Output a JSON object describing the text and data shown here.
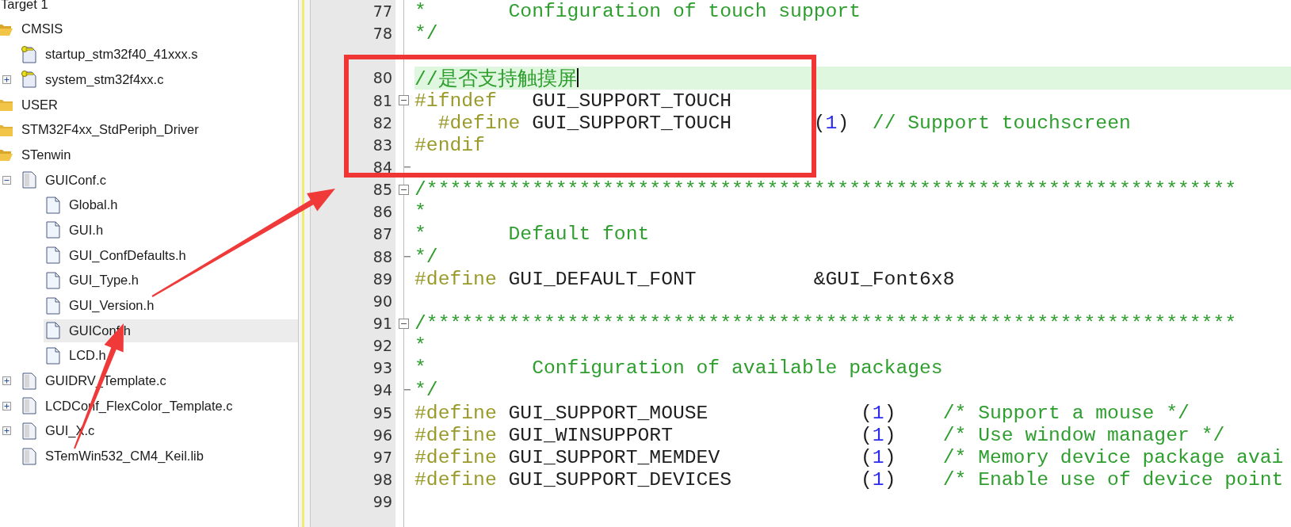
{
  "tree": {
    "items": [
      {
        "label": "Target 1",
        "selected": false,
        "children": [
          {
            "label": "CMSIS",
            "kind": "folder",
            "expanded": true,
            "selected": false,
            "children": [
              {
                "label": "startup_stm32f40_41xxx.s",
                "kind": "key_file",
                "selected": false
              },
              {
                "label": "system_stm32f4xx.c",
                "kind": "key_file",
                "expanded": false,
                "selected": false
              }
            ]
          },
          {
            "label": "USER",
            "kind": "folder",
            "expanded": false,
            "selected": false
          },
          {
            "label": "STM32F4xx_StdPeriph_Driver",
            "kind": "folder",
            "expanded": false,
            "selected": false
          },
          {
            "label": "STenwin",
            "kind": "folder",
            "expanded": true,
            "selected": false,
            "children": [
              {
                "label": "GUIConf.c",
                "kind": "source_file",
                "expanded": true,
                "selected": false,
                "children": [
                  {
                    "label": "Global.h",
                    "kind": "header_file",
                    "selected": false
                  },
                  {
                    "label": "GUI.h",
                    "kind": "header_file",
                    "selected": false
                  },
                  {
                    "label": "GUI_ConfDefaults.h",
                    "kind": "header_file",
                    "selected": false
                  },
                  {
                    "label": "GUI_Type.h",
                    "kind": "header_file",
                    "selected": false
                  },
                  {
                    "label": "GUI_Version.h",
                    "kind": "header_file",
                    "selected": false
                  },
                  {
                    "label": "GUIConf.h",
                    "kind": "header_file",
                    "selected": true
                  },
                  {
                    "label": "LCD.h",
                    "kind": "header_file",
                    "selected": false
                  }
                ]
              },
              {
                "label": "GUIDRV_Template.c",
                "kind": "source_file",
                "expanded": false,
                "selected": false
              },
              {
                "label": "LCDConf_FlexColor_Template.c",
                "kind": "source_file",
                "expanded": false,
                "selected": false
              },
              {
                "label": "GUI_X.c",
                "kind": "source_file",
                "expanded": false,
                "selected": false
              },
              {
                "label": "STemWin532_CM4_Keil.lib",
                "kind": "source_file",
                "selected": false
              }
            ]
          }
        ]
      }
    ]
  },
  "editor": {
    "lines": [
      {
        "number": "77",
        "highlighted": false,
        "tokens": [
          {
            "kind": "comment",
            "text": "*       Configuration of touch support"
          }
        ]
      },
      {
        "number": "78",
        "highlighted": false,
        "tokens": [
          {
            "kind": "comment",
            "text": "*/"
          }
        ]
      },
      {
        "highlighted": false
      },
      {
        "number": "80",
        "highlighted": true,
        "tokens": [
          {
            "kind": "comment",
            "text": "//是否支持触摸屏"
          }
        ]
      },
      {
        "number": "81",
        "kind": "fold_start",
        "highlighted": false,
        "tokens": [
          {
            "kind": "directive",
            "text": "#ifndef"
          },
          {
            "kind": "plain",
            "text": "   GUI_SUPPORT_TOUCH"
          }
        ]
      },
      {
        "number": "82",
        "highlighted": false,
        "tokens": [
          {
            "kind": "directive",
            "text": "  #define"
          },
          {
            "kind": "plain",
            "text": " GUI_SUPPORT_TOUCH       ("
          },
          {
            "kind": "number",
            "text": "1"
          },
          {
            "kind": "plain",
            "text": ")  "
          },
          {
            "kind": "comment",
            "text": "// Support touchscreen"
          }
        ]
      },
      {
        "number": "83",
        "highlighted": false,
        "tokens": [
          {
            "kind": "directive",
            "text": "#endif"
          }
        ]
      },
      {
        "number": "84",
        "kind": "fold_end",
        "highlighted": false
      },
      {
        "number": "85",
        "kind": "fold_start",
        "highlighted": false,
        "tokens": [
          {
            "kind": "comment",
            "text": "/*********************************************************************"
          }
        ]
      },
      {
        "number": "86",
        "highlighted": false,
        "tokens": [
          {
            "kind": "comment",
            "text": "*"
          }
        ]
      },
      {
        "number": "87",
        "highlighted": false,
        "tokens": [
          {
            "kind": "comment",
            "text": "*       Default font"
          }
        ]
      },
      {
        "number": "88",
        "kind": "fold_end",
        "highlighted": false,
        "tokens": [
          {
            "kind": "comment",
            "text": "*/"
          }
        ]
      },
      {
        "number": "89",
        "highlighted": false,
        "tokens": [
          {
            "kind": "directive",
            "text": "#define"
          },
          {
            "kind": "plain",
            "text": " GUI_DEFAULT_FONT          &GUI_Font6x8"
          }
        ]
      },
      {
        "number": "90",
        "highlighted": false
      },
      {
        "number": "91",
        "kind": "fold_start",
        "highlighted": false,
        "tokens": [
          {
            "kind": "comment",
            "text": "/*********************************************************************"
          }
        ]
      },
      {
        "number": "92",
        "highlighted": false,
        "tokens": [
          {
            "kind": "comment",
            "text": "*"
          }
        ]
      },
      {
        "number": "93",
        "highlighted": false,
        "tokens": [
          {
            "kind": "comment",
            "text": "*         Configuration of available packages"
          }
        ]
      },
      {
        "number": "94",
        "kind": "fold_end",
        "highlighted": false,
        "tokens": [
          {
            "kind": "comment",
            "text": "*/"
          }
        ]
      },
      {
        "number": "95",
        "highlighted": false,
        "tokens": [
          {
            "kind": "directive",
            "text": "#define"
          },
          {
            "kind": "plain",
            "text": " GUI_SUPPORT_MOUSE             ("
          },
          {
            "kind": "number",
            "text": "1"
          },
          {
            "kind": "plain",
            "text": ")    "
          },
          {
            "kind": "comment",
            "text": "/* Support a mouse */"
          }
        ]
      },
      {
        "number": "96",
        "highlighted": false,
        "tokens": [
          {
            "kind": "directive",
            "text": "#define"
          },
          {
            "kind": "plain",
            "text": " GUI_WINSUPPORT                ("
          },
          {
            "kind": "number",
            "text": "1"
          },
          {
            "kind": "plain",
            "text": ")    "
          },
          {
            "kind": "comment",
            "text": "/* Use window manager */"
          }
        ]
      },
      {
        "number": "97",
        "highlighted": false,
        "tokens": [
          {
            "kind": "directive",
            "text": "#define"
          },
          {
            "kind": "plain",
            "text": " GUI_SUPPORT_MEMDEV            ("
          },
          {
            "kind": "number",
            "text": "1"
          },
          {
            "kind": "plain",
            "text": ")    "
          },
          {
            "kind": "comment",
            "text": "/* Memory device package avai"
          }
        ]
      },
      {
        "number": "98",
        "highlighted": false,
        "tokens": [
          {
            "kind": "directive",
            "text": "#define"
          },
          {
            "kind": "plain",
            "text": " GUI_SUPPORT_DEVICES           ("
          },
          {
            "kind": "number",
            "text": "1"
          },
          {
            "kind": "plain",
            "text": ")    "
          },
          {
            "kind": "comment",
            "text": "/* Enable use of device point"
          }
        ]
      },
      {
        "number": "99",
        "highlighted": false
      }
    ]
  }
}
